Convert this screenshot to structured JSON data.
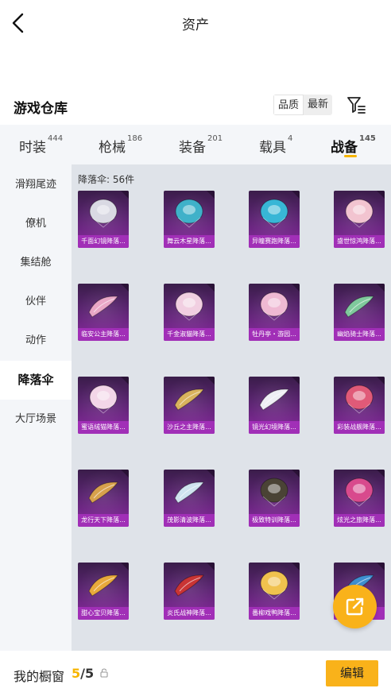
{
  "header": {
    "title": "资产"
  },
  "warehouse": {
    "title": "游戏仓库",
    "sort_options": [
      "品质",
      "最新"
    ],
    "sort_selected": "品质"
  },
  "tabs": [
    {
      "label": "时装",
      "count": "444"
    },
    {
      "label": "枪械",
      "count": "186"
    },
    {
      "label": "装备",
      "count": "201"
    },
    {
      "label": "载具",
      "count": "4"
    },
    {
      "label": "战备",
      "count": "145",
      "active": true
    }
  ],
  "sidebar": [
    {
      "label": "滑翔尾迹"
    },
    {
      "label": "僚机"
    },
    {
      "label": "集结舱"
    },
    {
      "label": "伙伴"
    },
    {
      "label": "动作"
    },
    {
      "label": "降落伞",
      "active": true
    },
    {
      "label": "大厅场景"
    }
  ],
  "grid": {
    "count_text": "降落伞: 56件",
    "items": [
      {
        "name": "千面幻镜降落...",
        "icon": "diamond-parachute",
        "color": "#d9d9e3"
      },
      {
        "name": "舞云木星降落...",
        "icon": "dragon-parachute",
        "color": "#3fb1c9"
      },
      {
        "name": "异瞳赛跑降落...",
        "icon": "cyan-dome-parachute",
        "color": "#38b6d6"
      },
      {
        "name": "盛世惊鸿降落...",
        "icon": "pink-flower-parachute",
        "color": "#f2c4d0"
      },
      {
        "name": "临安公主降落...",
        "icon": "pink-wing-parachute",
        "color": "#e9a7c6"
      },
      {
        "name": "千金淑貓降落...",
        "icon": "cat-parachute",
        "color": "#f1cfe1"
      },
      {
        "name": "牡丹亭・游园...",
        "icon": "peony-parachute",
        "color": "#efb9d3"
      },
      {
        "name": "幽焰骑士降落...",
        "icon": "green-wing-parachute",
        "color": "#7fc99c"
      },
      {
        "name": "蜜语绒猫降落...",
        "icon": "candy-dome-parachute",
        "color": "#f3d6e8"
      },
      {
        "name": "沙丘之主降落...",
        "icon": "sand-wing-parachute",
        "color": "#d9b35d"
      },
      {
        "name": "镜光幻境降落...",
        "icon": "white-wing-parachute",
        "color": "#eeeef4"
      },
      {
        "name": "彩装战舰降落...",
        "icon": "colorful-dome-parachute",
        "color": "#e05a78"
      },
      {
        "name": "龙行天下降落...",
        "icon": "dragon-wing-parachute",
        "color": "#d7a14c"
      },
      {
        "name": "茂影清波降落...",
        "icon": "silver-wing-parachute",
        "color": "#cfe3ef"
      },
      {
        "name": "极致特训降落...",
        "icon": "black-dome-parachute",
        "color": "#4a4335"
      },
      {
        "name": "炫光之旅降落...",
        "icon": "pattern-dome-parachute",
        "color": "#d84a8d"
      },
      {
        "name": "甜心宝贝降落...",
        "icon": "sweet-wing-parachute",
        "color": "#e8a93b"
      },
      {
        "name": "炎氏战神降落...",
        "icon": "red-wing-parachute",
        "color": "#c93434"
      },
      {
        "name": "番柳戏鸭降落...",
        "icon": "yellow-dome-parachute",
        "color": "#f0c24e"
      },
      {
        "name": "",
        "icon": "blue-wing-parachute",
        "color": "#3e8fd0"
      }
    ]
  },
  "bottom": {
    "shelf_label": "我的橱窗",
    "shelf_used": "5",
    "shelf_total": "/5",
    "edit_label": "编辑"
  },
  "colors": {
    "accent": "#f9b21a",
    "card_label": "#a12fb7"
  }
}
